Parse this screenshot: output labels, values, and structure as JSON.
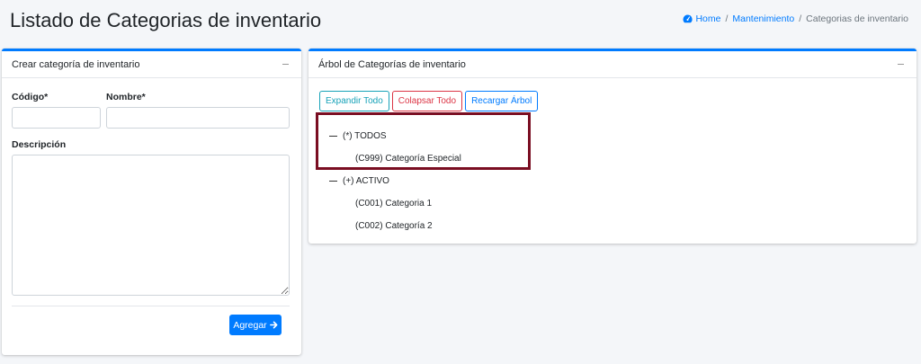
{
  "header": {
    "title": "Listado de Categorias de inventario",
    "breadcrumb": {
      "home": "Home",
      "section": "Mantenimiento",
      "current": "Categorias de inventario",
      "separator": "/"
    }
  },
  "form": {
    "card_title": "Crear categoría de inventario",
    "codigo_label": "Código*",
    "nombre_label": "Nombre*",
    "codigo_value": "",
    "nombre_value": "",
    "descripcion_label": "Descripción",
    "descripcion_value": "",
    "submit_label": "Agregar",
    "submit_icon": "arrow-right-icon"
  },
  "tree": {
    "card_title": "Árbol de Categorías de inventario",
    "buttons": {
      "expand": "Expandir Todo",
      "collapse": "Colapsar Todo",
      "reload": "Recargar Árbol"
    },
    "nodes": [
      {
        "label": "(*) TODOS",
        "children": [
          {
            "label": "(C999) Categoría Especial"
          }
        ]
      },
      {
        "label": "(+) ACTIVO",
        "children": [
          {
            "label": "(C001) Categoria 1"
          },
          {
            "label": "(C002) Categoría 2"
          }
        ]
      }
    ]
  },
  "colors": {
    "primary": "#007bff",
    "info": "#17a2b8",
    "danger": "#dc3545",
    "highlight": "#7a0e22"
  }
}
